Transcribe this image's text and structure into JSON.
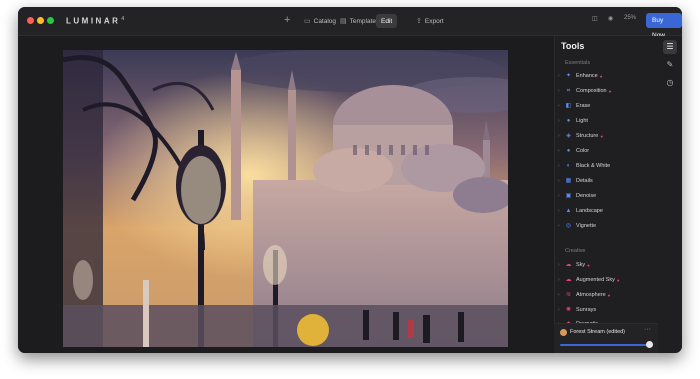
{
  "app": {
    "brand": "LUMINAR",
    "version": "4"
  },
  "toolbar": {
    "add_symbol": "+",
    "catalog": "Catalog",
    "templates": "Templates",
    "edit": "Edit",
    "export": "Export",
    "zoom": "25%",
    "buy_now": "Buy Now"
  },
  "tools_panel": {
    "title": "Tools",
    "essentials_label": "Essentials",
    "essentials": [
      {
        "label": "Enhance",
        "ai": true,
        "icon": "enhance-icon",
        "icon_color": "#5b8cff"
      },
      {
        "label": "Composition",
        "ai": true,
        "icon": "crop-icon",
        "icon_color": "#5b8cff"
      },
      {
        "label": "Erase",
        "ai": false,
        "icon": "erase-icon",
        "icon_color": "#5b8cff"
      },
      {
        "label": "Light",
        "ai": false,
        "icon": "light-icon",
        "icon_color": "#5b8cff"
      },
      {
        "label": "Structure",
        "ai": true,
        "icon": "structure-icon",
        "icon_color": "#5b8cff"
      },
      {
        "label": "Color",
        "ai": false,
        "icon": "color-icon",
        "icon_color": "#5b8cff"
      },
      {
        "label": "Black & White",
        "ai": false,
        "icon": "bw-icon",
        "icon_color": "#5b8cff"
      },
      {
        "label": "Details",
        "ai": false,
        "icon": "details-icon",
        "icon_color": "#5b8cff"
      },
      {
        "label": "Denoise",
        "ai": false,
        "icon": "denoise-icon",
        "icon_color": "#5b8cff"
      },
      {
        "label": "Landscape",
        "ai": false,
        "icon": "landscape-icon",
        "icon_color": "#5b8cff"
      },
      {
        "label": "Vignette",
        "ai": false,
        "icon": "vignette-icon",
        "icon_color": "#5b8cff"
      }
    ],
    "creative_label": "Creative",
    "creative": [
      {
        "label": "Sky",
        "ai": true,
        "icon": "sky-icon",
        "icon_color": "#e0446a"
      },
      {
        "label": "Augmented Sky",
        "ai": true,
        "icon": "augmented-sky-icon",
        "icon_color": "#e0446a"
      },
      {
        "label": "Atmosphere",
        "ai": true,
        "icon": "atmosphere-icon",
        "icon_color": "#e0446a"
      },
      {
        "label": "Sunrays",
        "ai": false,
        "icon": "sunrays-icon",
        "icon_color": "#e0446a"
      },
      {
        "label": "Dramatic",
        "ai": false,
        "icon": "dramatic-icon",
        "icon_color": "#e0446a"
      }
    ]
  },
  "preset": {
    "name": "Forest Stream (edited)",
    "amount": 1.0
  },
  "colors": {
    "accent": "#3a67d6",
    "ai_badge": "#e0446a"
  }
}
